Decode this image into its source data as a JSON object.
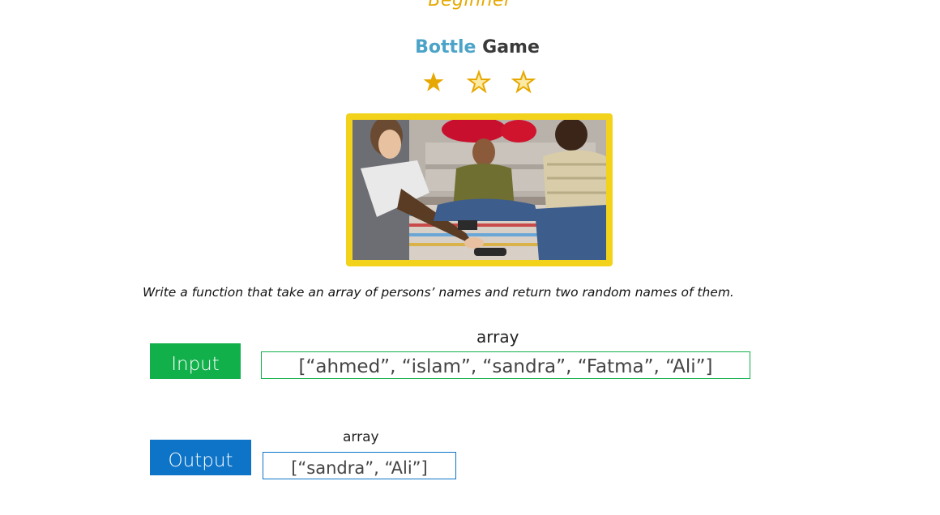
{
  "header": {
    "level": "Beginner",
    "title_part1": "Bottle",
    "title_part2": "Game"
  },
  "rating": {
    "stars": [
      "filled",
      "outline",
      "outline"
    ],
    "color": "#e6a800"
  },
  "picture": {
    "frame_color": "#f2d21b"
  },
  "task": {
    "description": "Write a function that take an array of persons’ names and return two random names of them."
  },
  "input": {
    "label": "Input",
    "type": "array",
    "value": "[“ahmed”, “islam”, “sandra”, “Fatma”, “Ali”]",
    "color": "#11b04b"
  },
  "output": {
    "label": "Output",
    "type": "array",
    "value": "[“sandra”, “Ali”]",
    "color": "#0d74c8"
  }
}
